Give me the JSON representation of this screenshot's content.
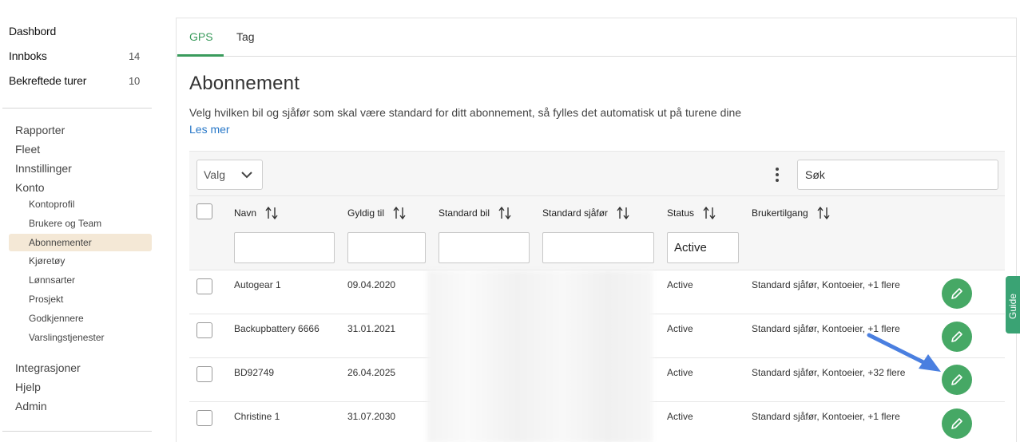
{
  "sidebar": {
    "top_items": [
      {
        "label": "Dashbord",
        "count": ""
      },
      {
        "label": "Innboks",
        "count": "14"
      },
      {
        "label": "Bekreftede turer",
        "count": "10"
      }
    ],
    "nav": [
      "Rapporter",
      "Fleet",
      "Innstillinger",
      "Konto"
    ],
    "sub": [
      "Kontoprofil",
      "Brukere og Team",
      "Abonnementer",
      "Kjøretøy",
      "Lønnsarter",
      "Prosjekt",
      "Godkjennere",
      "Varslingstjenester"
    ],
    "nav_bottom": [
      "Integrasjoner",
      "Hjelp",
      "Admin"
    ]
  },
  "tabs": [
    "GPS",
    "Tag"
  ],
  "page": {
    "title": "Abonnement",
    "description": "Velg hvilken bil og sjåfør som skal være standard for ditt abonnement, så fylles det automatisk ut på turene dine",
    "read_more": "Les mer"
  },
  "toolbar": {
    "select_label": "Valg",
    "search_placeholder": "Søk"
  },
  "columns": [
    "Navn",
    "Gyldig til",
    "Standard bil",
    "Standard sjåfør",
    "Status",
    "Brukertilgang"
  ],
  "filters": {
    "status_value": "Active"
  },
  "rows": [
    {
      "name": "Autogear 1",
      "valid_until": "09.04.2020",
      "status": "Active",
      "access": "Standard sjåfør, Kontoeier, +1 flere"
    },
    {
      "name": "Backupbattery 6666",
      "valid_until": "31.01.2021",
      "status": "Active",
      "access": "Standard sjåfør, Kontoeier, +1 flere"
    },
    {
      "name": "BD92749",
      "valid_until": "26.04.2025",
      "status": "Active",
      "access": "Standard sjåfør, Kontoeier, +32 flere"
    },
    {
      "name": "Christine 1",
      "valid_until": "31.07.2030",
      "status": "Active",
      "access": "Standard sjåfør, Kontoeier, +1 flere"
    }
  ],
  "guide_tab": "Guide",
  "colors": {
    "accent_green": "#3a9b5c",
    "button_green": "#46a865",
    "link_blue": "#2878c8",
    "active_nav_bg": "#f4e8d6",
    "arrow_blue": "#4a7fe0"
  }
}
